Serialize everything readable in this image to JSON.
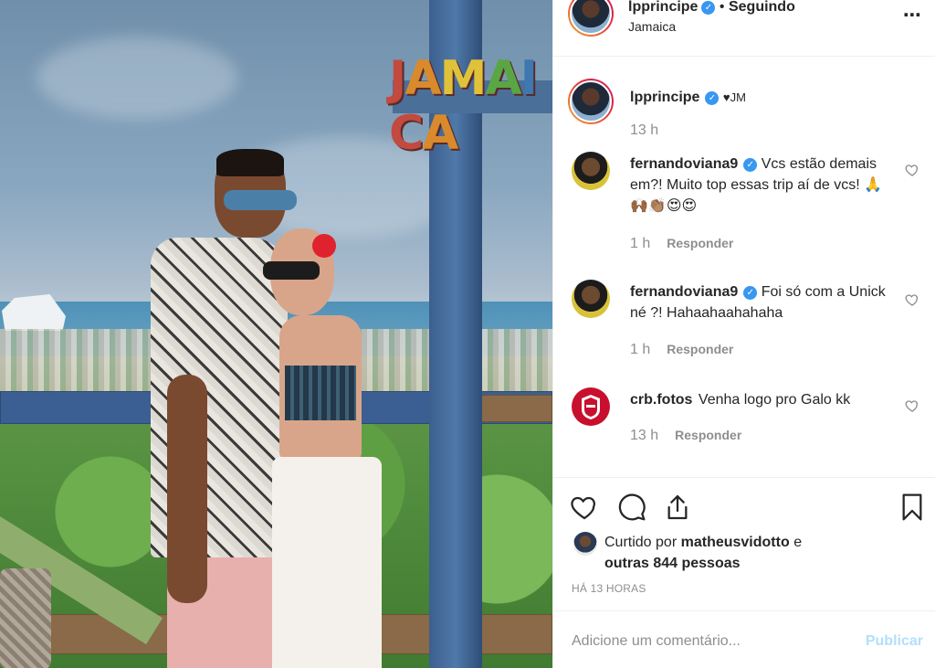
{
  "photo": {
    "sign_letters": [
      "J",
      "A",
      "M",
      "A",
      "I",
      "C",
      "A"
    ]
  },
  "post_header": {
    "username": "lpprincipe",
    "separator": "•",
    "follow_status": "Seguindo",
    "location": "Jamaica",
    "more_icon": "⋯"
  },
  "caption": {
    "username": "lpprincipe",
    "text": "♥JM",
    "time": "13 h"
  },
  "comments": [
    {
      "username": "fernandoviana9",
      "verified": true,
      "text": "Vcs estão demais em?! Muito top essas trip aí de vcs! 🙏🙌🏾👏🏽😍😍",
      "time": "1 h",
      "reply_label": "Responder"
    },
    {
      "username": "fernandoviana9",
      "verified": true,
      "text": "Foi só com a Unick né ?! Hahaahaahahaha",
      "time": "1 h",
      "reply_label": "Responder"
    },
    {
      "username": "crb.fotos",
      "verified": false,
      "text": "Venha logo pro Galo kk",
      "time": "13 h",
      "reply_label": "Responder"
    }
  ],
  "actions": {
    "like_icon": "heart-icon",
    "comment_icon": "comment-icon",
    "share_icon": "share-icon",
    "save_icon": "bookmark-icon"
  },
  "likes": {
    "prefix": "Curtido por",
    "user": "matheusvidotto",
    "conj": "e",
    "others": "outras 844 pessoas"
  },
  "timestamp": "HÁ 13 HORAS",
  "comment_box": {
    "placeholder": "Adicione um comentário...",
    "post_label": "Publicar"
  },
  "colors": {
    "verified_blue": "#3897f0",
    "publish_disabled": "#b2dffc",
    "crb_red": "#c8102e"
  }
}
